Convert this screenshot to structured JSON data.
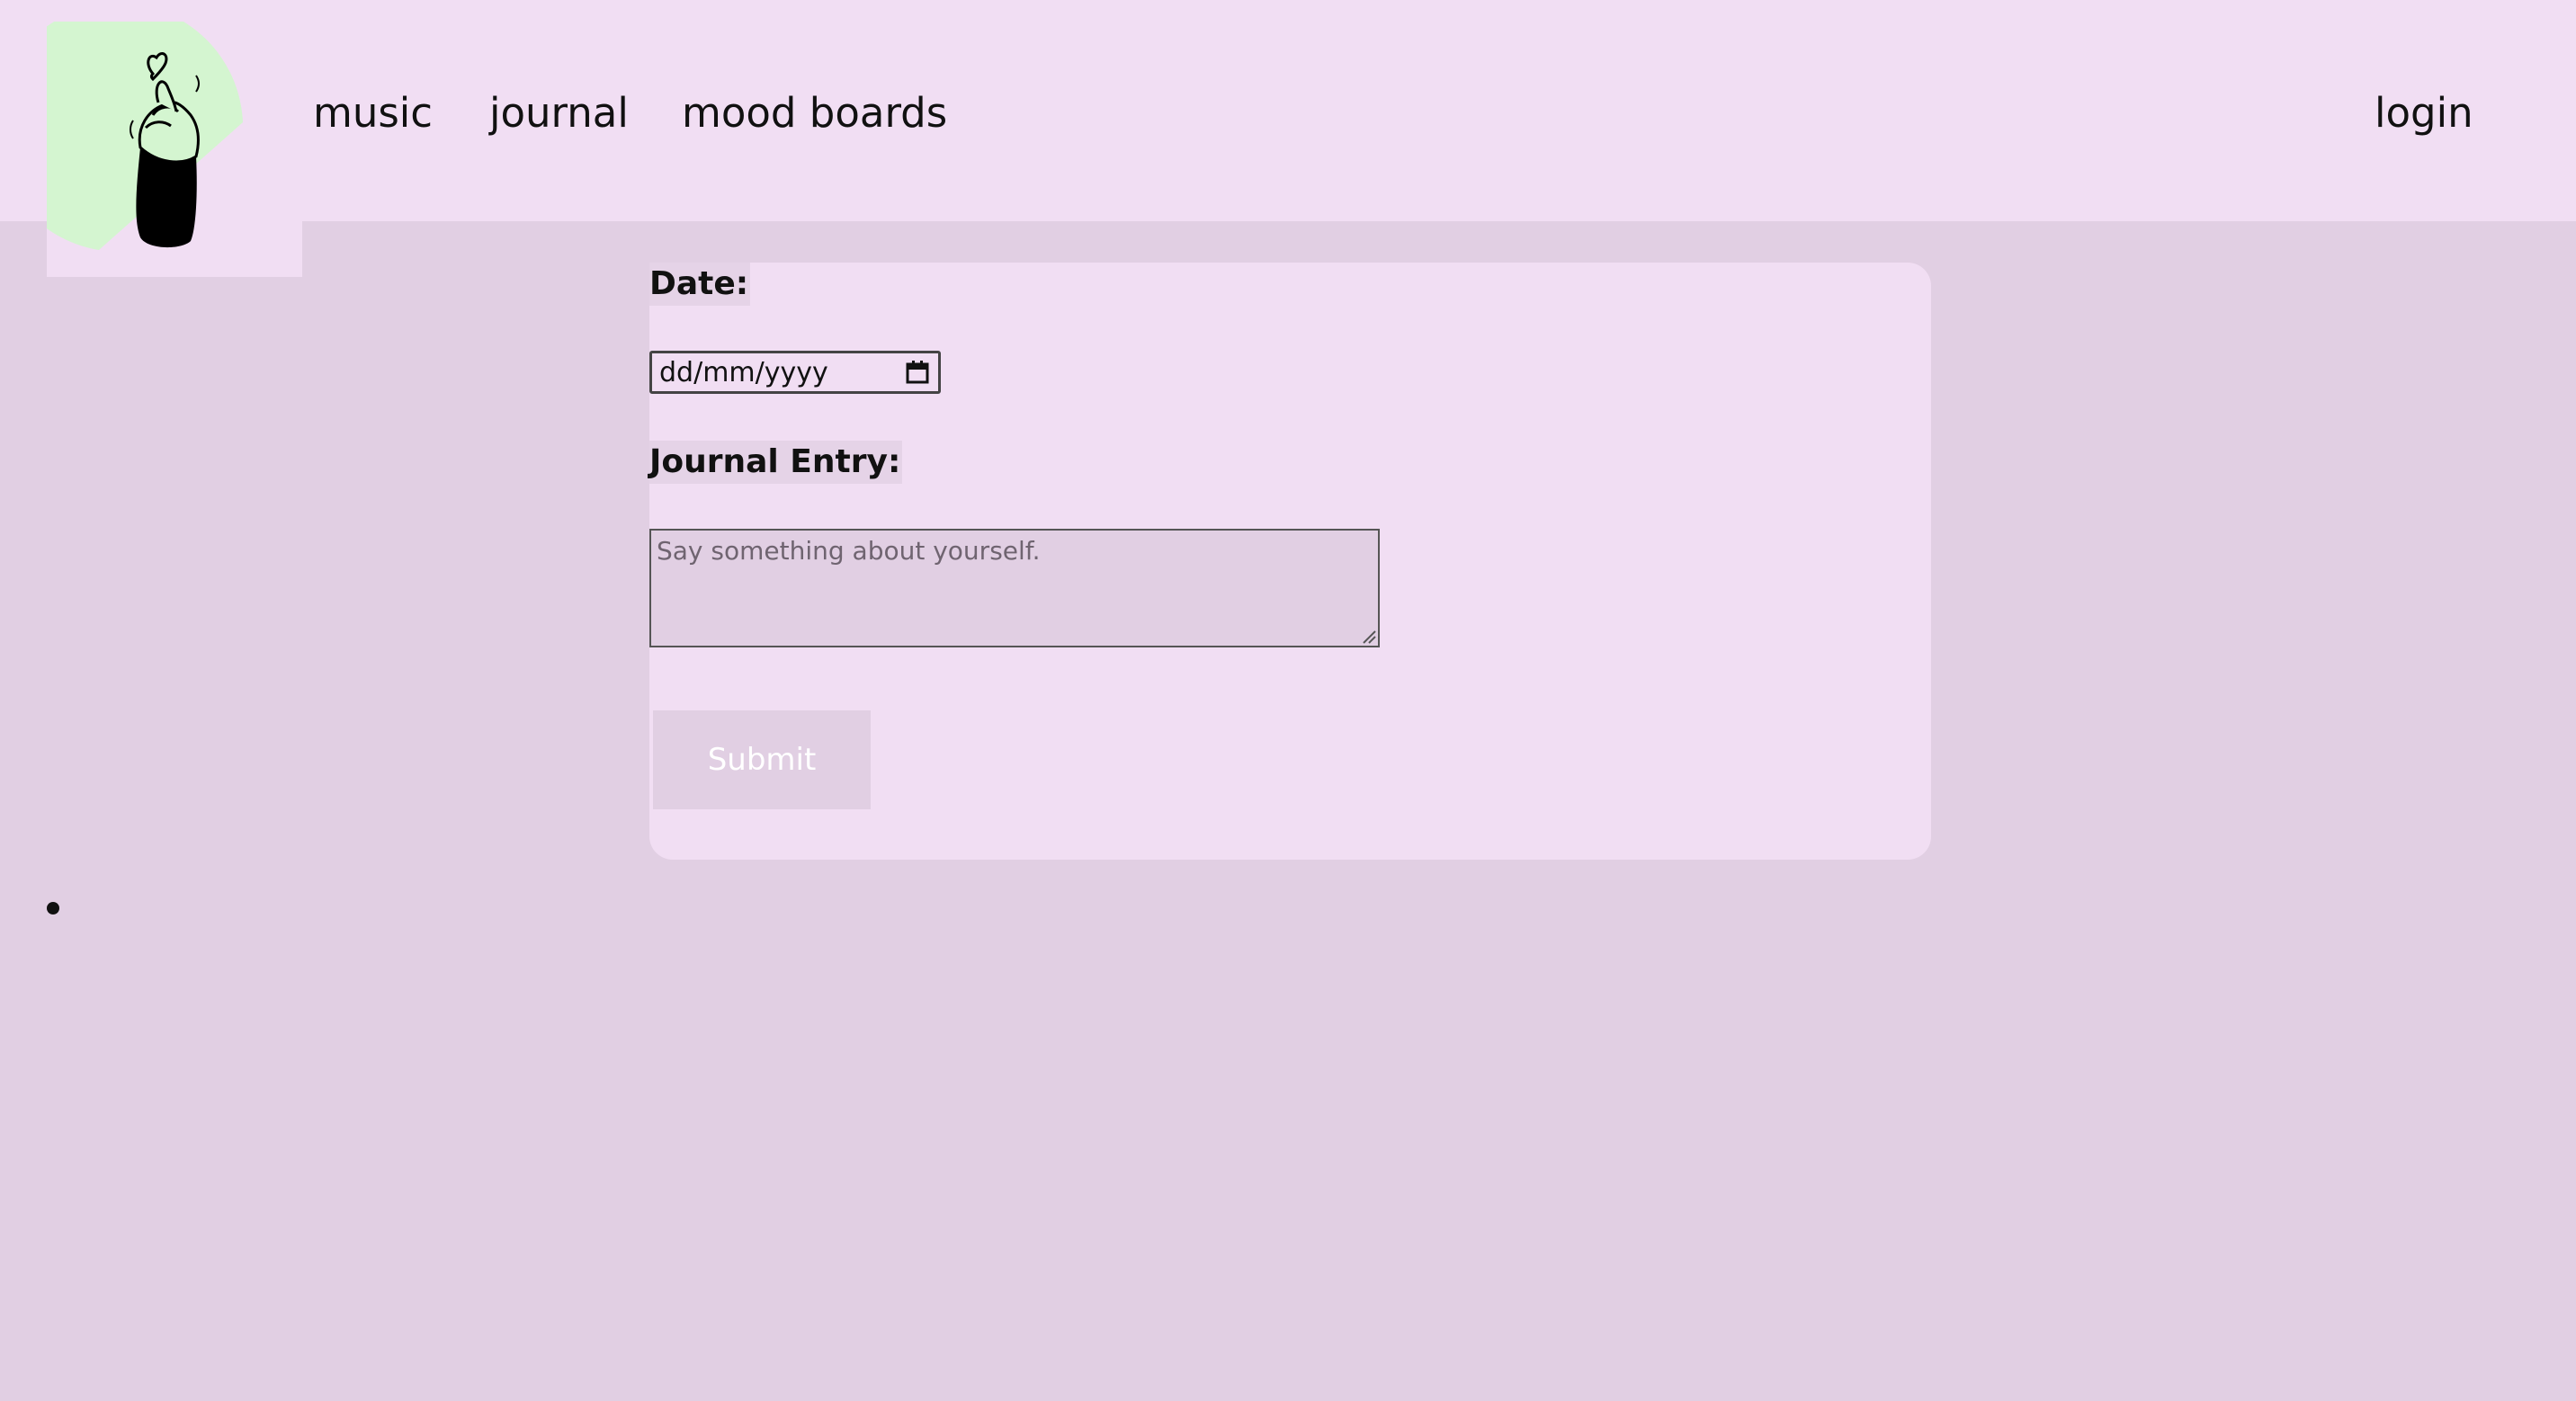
{
  "nav": {
    "links": [
      {
        "label": "music"
      },
      {
        "label": "journal"
      },
      {
        "label": "mood boards"
      }
    ],
    "login_label": "login"
  },
  "logo": {
    "icon": "finger-heart-hand-icon",
    "accent_color": "#d4f5d0"
  },
  "form": {
    "date_label": "Date:",
    "date_value": "dd/mm/yyyy",
    "entry_label": "Journal Entry:",
    "entry_placeholder": "Say something about yourself.",
    "submit_label": "Submit"
  },
  "colors": {
    "page_background": "#e1cfe3",
    "header_background": "#f1def3",
    "card_background": "#f1def3",
    "text": "#111111",
    "submit_text": "#ffffff"
  }
}
